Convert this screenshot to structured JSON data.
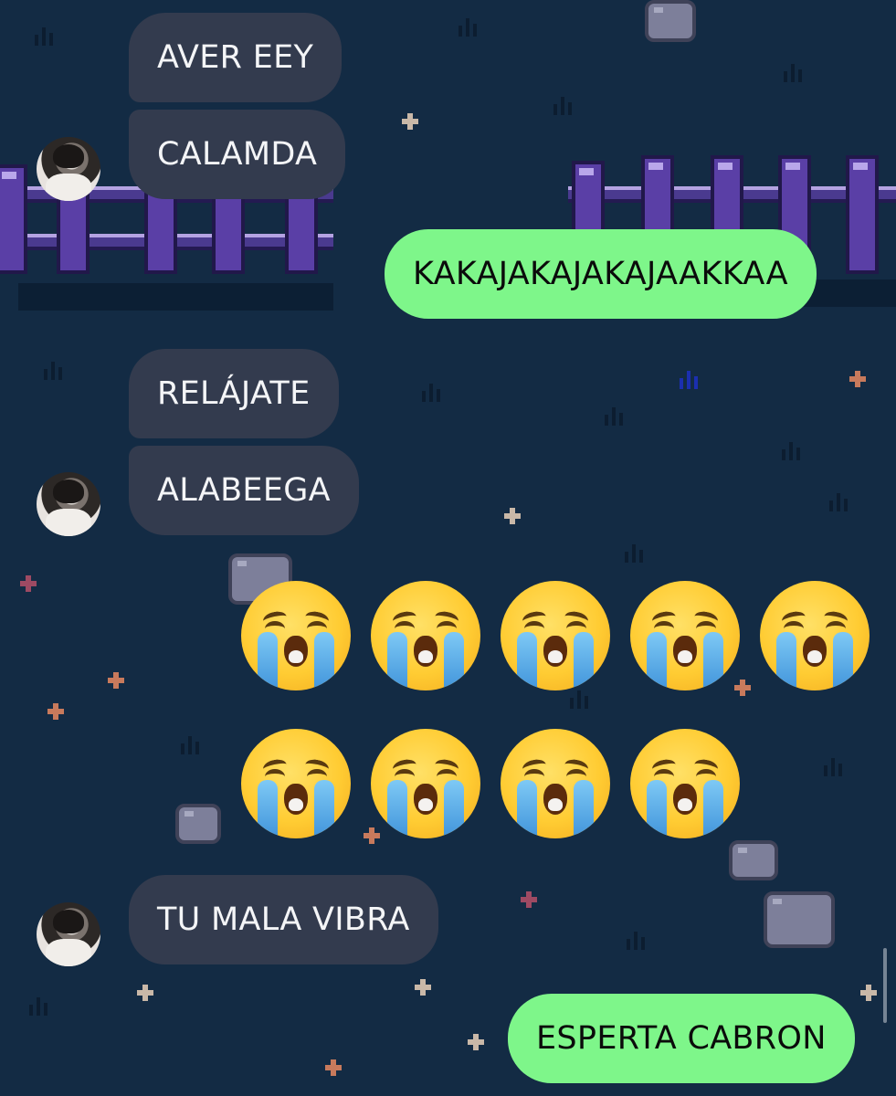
{
  "messages": [
    {
      "side": "incoming",
      "text": "AVER EEY"
    },
    {
      "side": "incoming",
      "text": "CALAMDA"
    },
    {
      "side": "outgoing",
      "text": "KAKAJAKAJAKAJAAKKAA"
    },
    {
      "side": "incoming",
      "text": "RELÁJATE"
    },
    {
      "side": "incoming",
      "text": "ALABEEGA"
    },
    {
      "side": "outgoing",
      "text": "😭😭😭😭😭😭😭😭😭",
      "emoji": "loudly-crying-face",
      "count": 9
    },
    {
      "side": "incoming",
      "text": "TU MALA VIBRA"
    },
    {
      "side": "outgoing",
      "text": "ESPERTA CABRON"
    }
  ],
  "colors": {
    "background": "#132b44",
    "incoming_bubble": "#333b4e",
    "outgoing_bubble": "#7ef68a",
    "fence": "#5a3fa6"
  },
  "background_theme": "pixel-art night garden with purple fence"
}
